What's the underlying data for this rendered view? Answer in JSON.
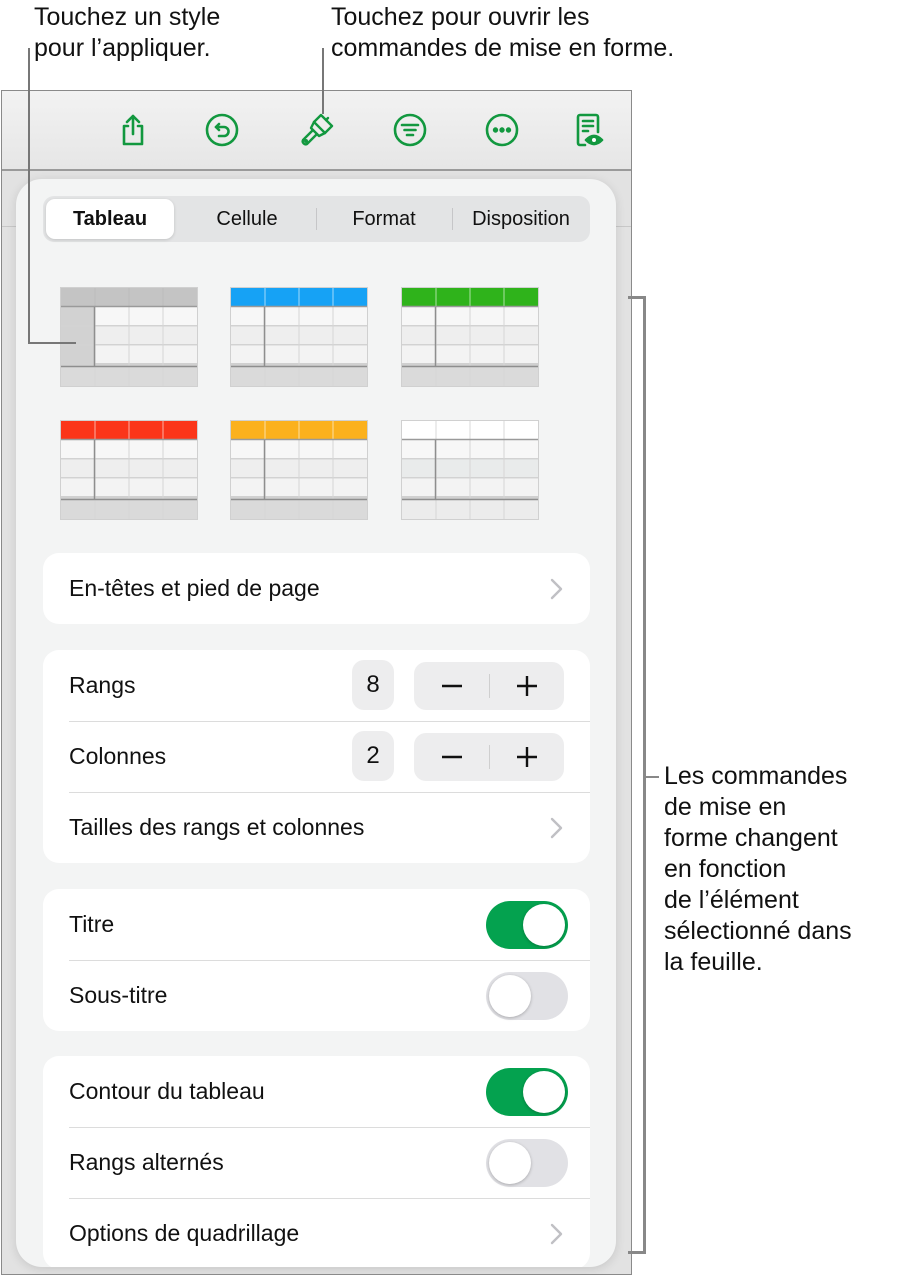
{
  "callouts": {
    "style_hint": "Touchez un style\npour l’appliquer.",
    "format_hint": "Touchez pour ouvrir les\ncommandes de mise en forme.",
    "controls_hint": "Les commandes\nde mise en\nforme changent\nen fonction\nde l’élément\nsélectionné dans\nla feuille."
  },
  "toolbar": {
    "accent_color": "#12983f",
    "icons": [
      "share-icon",
      "undo-icon",
      "paintbrush-icon",
      "filter-icon",
      "more-icon",
      "document-view-icon"
    ]
  },
  "tabs": [
    {
      "label": "Tableau",
      "active": true
    },
    {
      "label": "Cellule",
      "active": false
    },
    {
      "label": "Format",
      "active": false
    },
    {
      "label": "Disposition",
      "active": false
    }
  ],
  "table_styles": [
    {
      "name": "gray",
      "header_color": "#c4c4c4"
    },
    {
      "name": "blue",
      "header_color": "#16a2f5"
    },
    {
      "name": "green",
      "header_color": "#2fb31b"
    },
    {
      "name": "red",
      "header_color": "#fb3519"
    },
    {
      "name": "yellow",
      "header_color": "#fbb11d"
    },
    {
      "name": "plain",
      "header_color": "#ffffff"
    }
  ],
  "headers_footer": {
    "label": "En-têtes et pied de page"
  },
  "rows_cols": {
    "rows_label": "Rangs",
    "rows_value": "8",
    "cols_label": "Colonnes",
    "cols_value": "2",
    "sizes_label": "Tailles des rangs et colonnes",
    "minus": "−",
    "plus": "+"
  },
  "title_group": {
    "title_label": "Titre",
    "title_on": true,
    "subtitle_label": "Sous-titre",
    "subtitle_on": false
  },
  "border_group": {
    "outline_label": "Contour du tableau",
    "outline_on": true,
    "alternating_label": "Rangs alternés",
    "alternating_on": false,
    "gridlines_label": "Options de quadrillage"
  }
}
